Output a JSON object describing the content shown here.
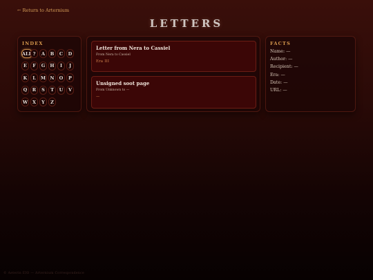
{
  "nav": {
    "back_label": "← Return to Arternium"
  },
  "page": {
    "title": "LETTERS"
  },
  "index": {
    "heading": "INDEX",
    "letters": [
      "ALL",
      "?",
      "A",
      "B",
      "C",
      "D",
      "E",
      "F",
      "G",
      "H",
      "I",
      "J",
      "K",
      "L",
      "M",
      "N",
      "O",
      "P",
      "Q",
      "R",
      "S",
      "T",
      "U",
      "V",
      "W",
      "X",
      "Y",
      "Z"
    ],
    "selected": "ALL"
  },
  "letters_list": [
    {
      "title": "Letter from Nera to Cassiel",
      "meta": "From Nera to Cassiel",
      "era": "Era III"
    },
    {
      "title": "Unsigned soot page",
      "meta": "From Unknown to —",
      "era": "—"
    }
  ],
  "facts": {
    "heading": "FACTS",
    "rows": [
      {
        "label": "Name:",
        "value": "—"
      },
      {
        "label": "Author:",
        "value": "—"
      },
      {
        "label": "Recipient:",
        "value": "—"
      },
      {
        "label": "Era:",
        "value": "—"
      },
      {
        "label": "Date:",
        "value": "—"
      },
      {
        "label": "URL:",
        "value": "—"
      }
    ]
  },
  "footer": {
    "text": "© Aeterin EIO — Arternium Correspondence"
  },
  "colors": {
    "accent": "#d99a4e",
    "card_bg": "#3b0606",
    "border": "#6b1d14"
  }
}
